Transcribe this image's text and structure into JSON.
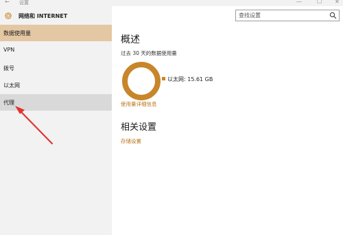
{
  "window": {
    "back_glyph": "←",
    "title": "设置",
    "minimize_glyph": "—",
    "maximize_glyph": "☐",
    "close_glyph": "✕"
  },
  "header": {
    "title": "网络和 INTERNET",
    "icon": "gear-icon",
    "search_placeholder": "查找设置",
    "search_icon": "search-icon"
  },
  "sidebar": {
    "items": [
      {
        "label": "数据使用量",
        "state": "selected"
      },
      {
        "label": "VPN",
        "state": "normal"
      },
      {
        "label": "拨号",
        "state": "normal"
      },
      {
        "label": "以太网",
        "state": "normal"
      },
      {
        "label": "代理",
        "state": "hover"
      }
    ]
  },
  "main": {
    "title": "概述",
    "subtitle": "过去 30 天的数据使用量",
    "usage": {
      "legend_label": "以太网: 15.61 GB",
      "fraction": 1.0,
      "color": "#c8862a"
    },
    "details_link": "使用量详细信息",
    "related_title": "相关设置",
    "storage_link": "存储设置"
  },
  "colors": {
    "accent": "#c8862a",
    "selected_bg": "#e4c7a3",
    "sidebar_bg": "#f2f2f2",
    "annotation_arrow": "#e2342d"
  }
}
